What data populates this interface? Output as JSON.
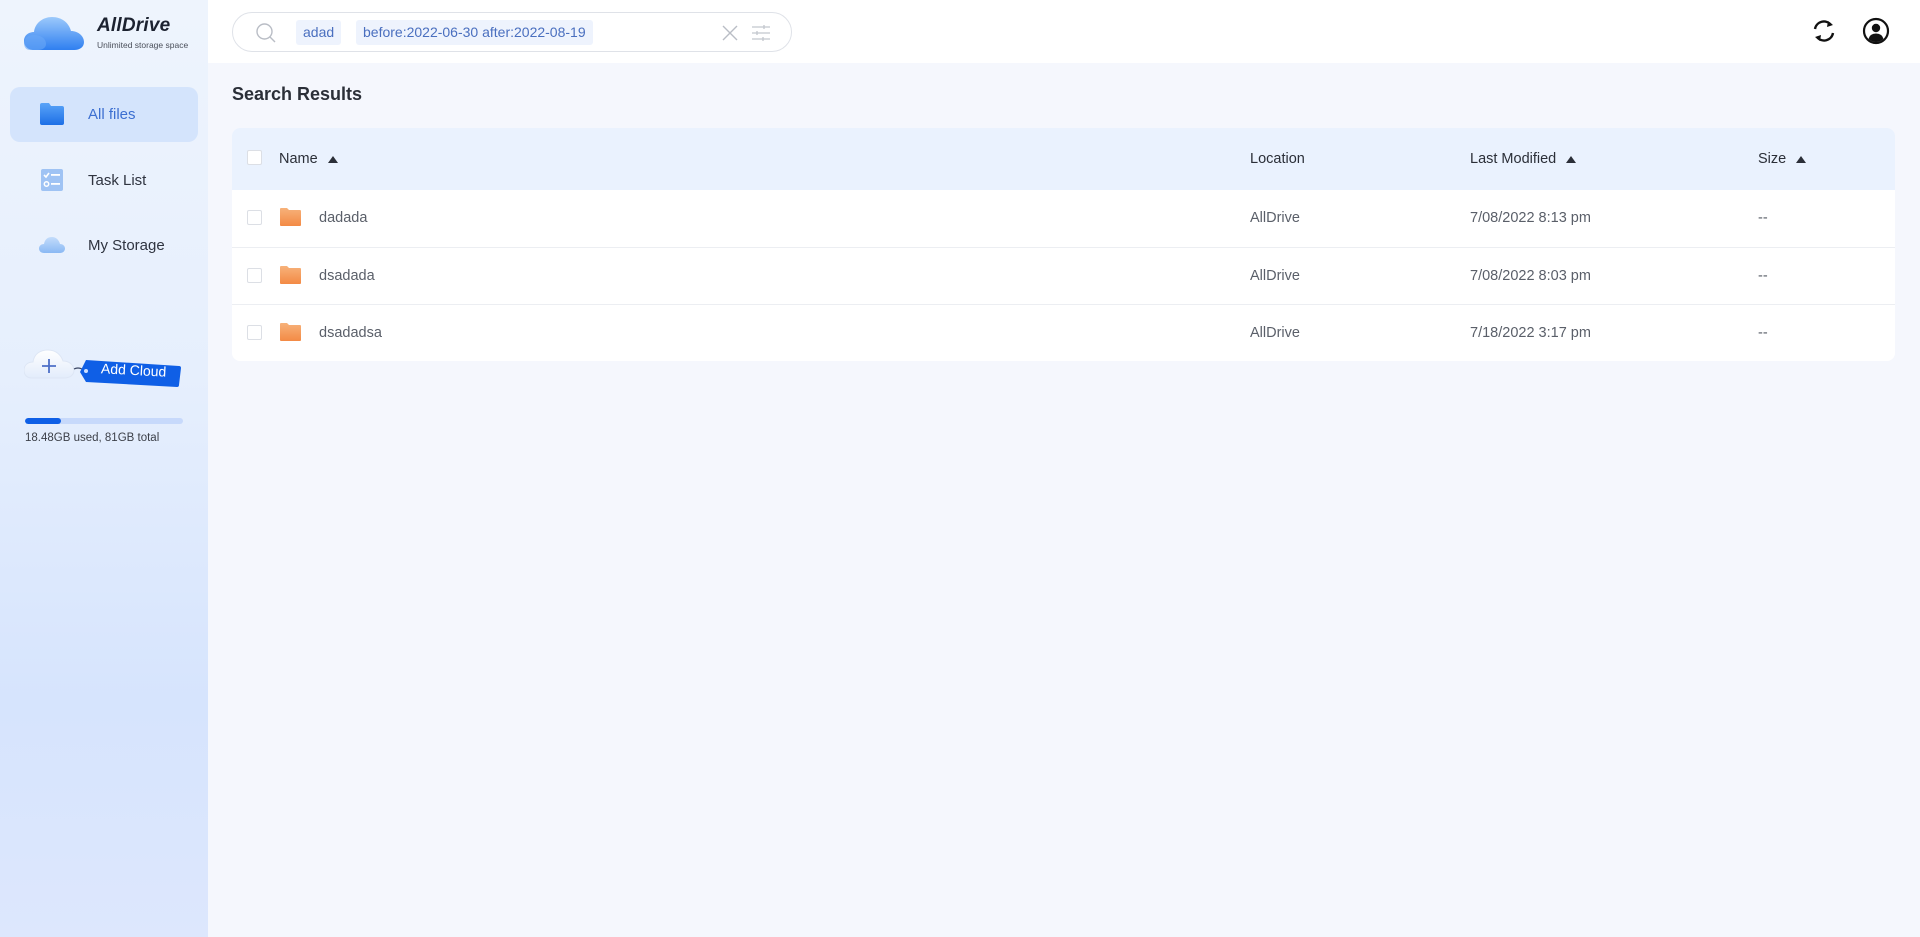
{
  "app": {
    "name": "AllDrive",
    "tagline": "Unlimited storage space"
  },
  "sidebar": {
    "items": [
      {
        "label": "All files",
        "icon": "folder-icon",
        "active": true
      },
      {
        "label": "Task List",
        "icon": "task-list-icon",
        "active": false
      },
      {
        "label": "My Storage",
        "icon": "cloud-icon",
        "active": false
      }
    ],
    "add_cloud_label": "Add Cloud",
    "storage": {
      "used_fraction": 0.228,
      "text": "18.48GB used, 81GB total"
    }
  },
  "header": {
    "search": {
      "keyword_chip": "adad",
      "date_chip": "before:2022-06-30 after:2022-08-19",
      "icons": [
        "search-icon",
        "clear-icon",
        "filter-icon"
      ]
    },
    "actions": [
      "sync-icon",
      "user-account-icon"
    ]
  },
  "main": {
    "title": "Search Results",
    "columns": {
      "name": "Name",
      "location": "Location",
      "last_modified": "Last Modified",
      "size": "Size"
    },
    "rows": [
      {
        "name": "dadada",
        "location": "AllDrive",
        "last_modified": "7/08/2022 8:13 pm",
        "size": "--"
      },
      {
        "name": "dsadada",
        "location": "AllDrive",
        "last_modified": "7/08/2022 8:03 pm",
        "size": "--"
      },
      {
        "name": "dsadadsa",
        "location": "AllDrive",
        "last_modified": "7/18/2022 3:17 pm",
        "size": "--"
      }
    ]
  },
  "colors": {
    "accent": "#0f5fe6",
    "active_nav_bg": "#d4e4fc",
    "active_nav_text": "#3c6fd1",
    "folder": "#f6a260",
    "table_header_bg": "#eaf2fe"
  }
}
